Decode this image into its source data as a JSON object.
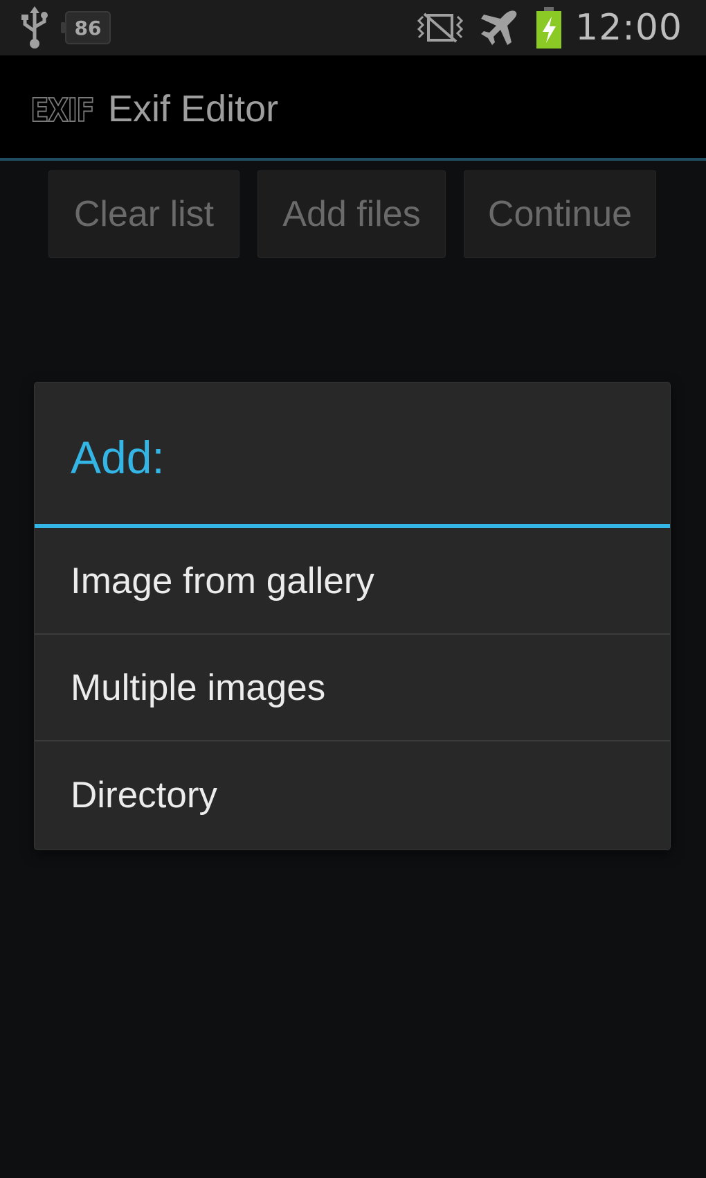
{
  "status_bar": {
    "notification_count": "86",
    "time": "12:00",
    "icons": [
      "usb-icon",
      "notification-badge",
      "vibrate-icon",
      "airplane-mode-icon",
      "battery-charging-icon"
    ]
  },
  "action_bar": {
    "logo_text": "EXIF",
    "title": "Exif Editor"
  },
  "toolbar": {
    "clear_label": "Clear list",
    "add_label": "Add files",
    "continue_label": "Continue"
  },
  "dialog": {
    "title": "Add:",
    "items": [
      {
        "label": "Image from gallery"
      },
      {
        "label": "Multiple images"
      },
      {
        "label": "Directory"
      }
    ]
  },
  "colors": {
    "accent": "#33b5e5",
    "battery": "#8bc925",
    "background": "#0e0f11"
  }
}
